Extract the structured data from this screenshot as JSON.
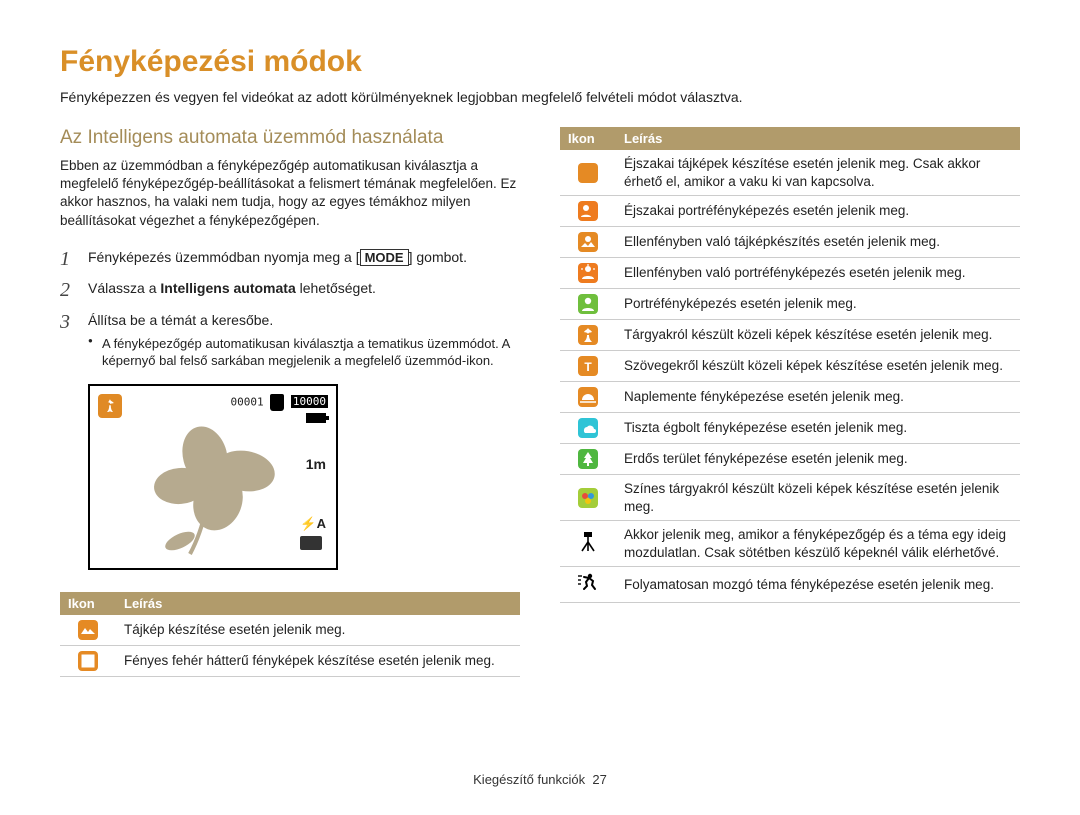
{
  "title": "Fényképezési módok",
  "lead": "Fényképezzen és vegyen fel videókat az adott körülményeknek legjobban megfelelő felvételi módot választva.",
  "section": {
    "heading": "Az Intelligens automata üzemmód használata",
    "intro": "Ebben az üzemmódban a fényképezőgép automatikusan kiválasztja a megfelelő fényképezőgép-beállításokat a felismert témának megfelelően. Ez akkor hasznos, ha valaki nem tudja, hogy az egyes témákhoz milyen beállításokat végezhet a fényképezőgépen."
  },
  "steps": {
    "s1_a": "Fényképezés üzemmódban nyomja meg a ",
    "s1_key": "MODE",
    "s1_b": " gombot.",
    "s2_a": "Válassza a ",
    "s2_bold": "Intelligens automata",
    "s2_b": " lehetőséget.",
    "s3": "Állítsa be a témát a keresőbe.",
    "s3_bullet": "A fényképezőgép automatikusan kiválasztja a tematikus üzemmódot. A képernyő bal felső sarkában megjelenik a megfelelő üzemmód-ikon."
  },
  "preview": {
    "counter": "00001",
    "size_label": "10000",
    "iso_label": "1m",
    "flash_label": "⚡A"
  },
  "table_headers": {
    "icon": "Ikon",
    "desc": "Leírás"
  },
  "left_table": [
    {
      "desc": "Tájkép készítése esetén jelenik meg."
    },
    {
      "desc": "Fényes fehér hátterű fényképek készítése esetén jelenik meg."
    }
  ],
  "right_table": [
    {
      "desc": "Éjszakai tájképek készítése esetén jelenik meg. Csak akkor érhető el, amikor a vaku ki van kapcsolva."
    },
    {
      "desc": "Éjszakai portréfényképezés esetén jelenik meg."
    },
    {
      "desc": "Ellenfényben való tájképkészítés esetén jelenik meg."
    },
    {
      "desc": "Ellenfényben való portréfényképezés esetén jelenik meg."
    },
    {
      "desc": "Portréfényképezés esetén jelenik meg."
    },
    {
      "desc": "Tárgyakról készült közeli képek készítése esetén jelenik meg."
    },
    {
      "desc": "Szövegekről készült közeli képek készítése esetén jelenik meg."
    },
    {
      "desc": "Naplemente fényképezése esetén jelenik meg."
    },
    {
      "desc": "Tiszta égbolt fényképezése esetén jelenik meg."
    },
    {
      "desc": "Erdős terület fényképezése esetén jelenik meg."
    },
    {
      "desc": "Színes tárgyakról készült közeli képek készítése esetén jelenik meg."
    },
    {
      "desc": "Akkor jelenik meg, amikor a fényképezőgép és a téma egy ideig mozdulatlan. Csak sötétben készülő képeknél válik elérhetővé."
    },
    {
      "desc": "Folyamatosan mozgó téma fényképezése esetén jelenik meg."
    }
  ],
  "footer": {
    "section": "Kiegészítő funkciók",
    "page": "27"
  }
}
